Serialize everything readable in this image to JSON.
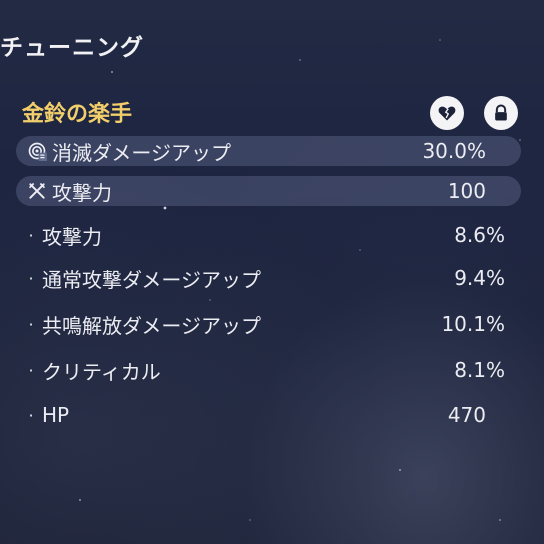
{
  "header": {
    "title": "チューニング"
  },
  "echo": {
    "name": "金鈴の楽手",
    "icons": {
      "favorite": "broken-heart-icon",
      "lock": "lock-icon"
    }
  },
  "main_stats": [
    {
      "icon": "damage-swirl-icon",
      "label": "消滅ダメージアップ",
      "value": "30.0%"
    },
    {
      "icon": "crossed-swords-icon",
      "label": "攻撃力",
      "value": "100"
    }
  ],
  "sub_stats": [
    {
      "label": "攻撃力",
      "value": "8.6%"
    },
    {
      "label": "通常攻撃ダメージアップ",
      "value": "9.4%"
    },
    {
      "label": "共鳴解放ダメージアップ",
      "value": "10.1%"
    },
    {
      "label": "クリティカル",
      "value": "8.1%"
    },
    {
      "label": "HP",
      "value": "470"
    }
  ],
  "colors": {
    "accent": "#f2cf6a",
    "text": "#ecedf2",
    "row_bg": "#5f698c"
  }
}
